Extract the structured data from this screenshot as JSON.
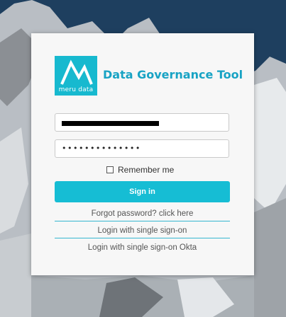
{
  "colors": {
    "accent": "#16bdd4",
    "title": "#18a3c4",
    "background_sky": "#1e3f5f"
  },
  "logo": {
    "icon": "meru-mountain-logo-icon",
    "text": "meru data"
  },
  "app_title": "Data Governance Tool",
  "form": {
    "email_value": "",
    "password_value": "••••••••••••••",
    "remember_label": "Remember me",
    "remember_checked": false,
    "signin_label": "Sign in"
  },
  "links": {
    "forgot": "Forgot password? click here",
    "sso": "Login with single sign-on",
    "sso_okta": "Login with single sign-on Okta"
  }
}
